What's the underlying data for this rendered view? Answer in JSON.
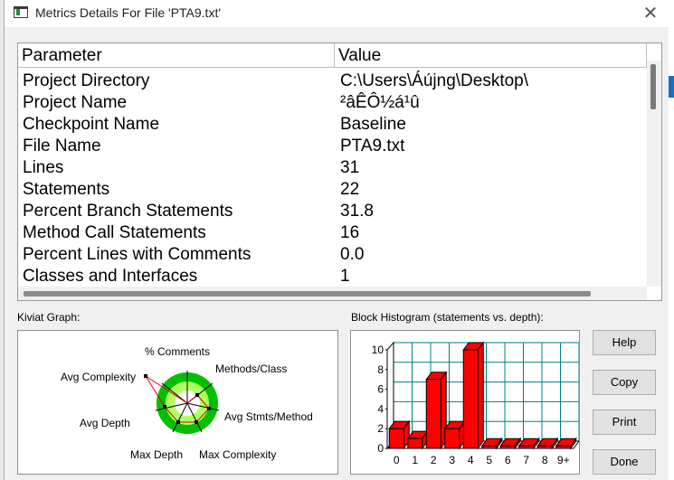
{
  "window": {
    "title": "Metrics Details For File 'PTA9.txt'",
    "close_glyph": "✕"
  },
  "table": {
    "headers": [
      "Parameter",
      "Value"
    ],
    "rows": [
      {
        "param": "Project Directory",
        "value": "C:\\Users\\Áújng\\Desktop\\"
      },
      {
        "param": "Project Name",
        "value": "²âÊÔ½á¹û"
      },
      {
        "param": "Checkpoint Name",
        "value": "Baseline"
      },
      {
        "param": "File Name",
        "value": "PTA9.txt"
      },
      {
        "param": "Lines",
        "value": "31"
      },
      {
        "param": "Statements",
        "value": "22"
      },
      {
        "param": "Percent Branch Statements",
        "value": "31.8"
      },
      {
        "param": "Method Call Statements",
        "value": "16"
      },
      {
        "param": "Percent Lines with Comments",
        "value": "0.0"
      },
      {
        "param": "Classes and Interfaces",
        "value": "1"
      }
    ]
  },
  "kiviat": {
    "label": "Kiviat Graph:",
    "axes": [
      "% Comments",
      "Methods/Class",
      "Avg Stmts/Method",
      "Max Complexity",
      "Max Depth",
      "Avg Depth",
      "Avg Complexity"
    ]
  },
  "histogram": {
    "label": "Block Histogram (statements vs. depth):",
    "bar_color": "#ff0000",
    "grid_color": "#008080"
  },
  "chart_data": {
    "type": "bar",
    "categories": [
      "0",
      "1",
      "2",
      "3",
      "4",
      "5",
      "6",
      "7",
      "8",
      "9+"
    ],
    "values": [
      2,
      1,
      7,
      2,
      10,
      0,
      0,
      0,
      0,
      0
    ],
    "title": "",
    "xlabel": "",
    "ylabel": "",
    "ylim": [
      0,
      10
    ],
    "yticks": [
      "0",
      "2",
      "4",
      "6",
      "8",
      "10"
    ]
  },
  "buttons": {
    "help": "Help",
    "copy": "Copy",
    "print": "Print",
    "done": "Done"
  }
}
